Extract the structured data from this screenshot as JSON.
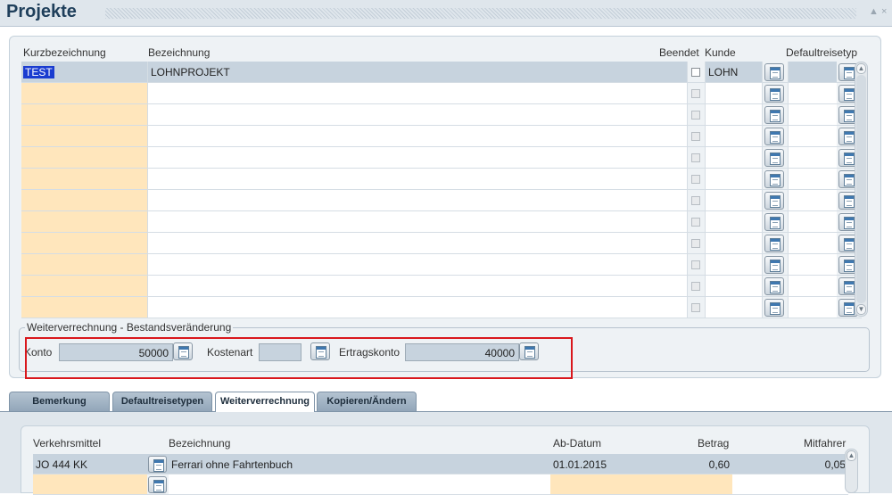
{
  "window": {
    "title": "Projekte",
    "minimize_glyph": "▲",
    "close_glyph": "×"
  },
  "projects": {
    "headers": {
      "kurz": "Kurzbezeichnung",
      "bezeichnung": "Bezeichnung",
      "beendet": "Beendet",
      "kunde": "Kunde",
      "defaultreisetyp": "Defaultreisetyp"
    },
    "rows": [
      {
        "kurz": "TEST",
        "bezeichnung": "LOHNPROJEKT",
        "beendet": false,
        "kunde": "LOHN",
        "reisetyp": ""
      },
      {
        "kurz": "",
        "bezeichnung": "",
        "beendet": false,
        "kunde": "",
        "reisetyp": ""
      },
      {
        "kurz": "",
        "bezeichnung": "",
        "beendet": false,
        "kunde": "",
        "reisetyp": ""
      },
      {
        "kurz": "",
        "bezeichnung": "",
        "beendet": false,
        "kunde": "",
        "reisetyp": ""
      },
      {
        "kurz": "",
        "bezeichnung": "",
        "beendet": false,
        "kunde": "",
        "reisetyp": ""
      },
      {
        "kurz": "",
        "bezeichnung": "",
        "beendet": false,
        "kunde": "",
        "reisetyp": ""
      },
      {
        "kurz": "",
        "bezeichnung": "",
        "beendet": false,
        "kunde": "",
        "reisetyp": ""
      },
      {
        "kurz": "",
        "bezeichnung": "",
        "beendet": false,
        "kunde": "",
        "reisetyp": ""
      },
      {
        "kurz": "",
        "bezeichnung": "",
        "beendet": false,
        "kunde": "",
        "reisetyp": ""
      },
      {
        "kurz": "",
        "bezeichnung": "",
        "beendet": false,
        "kunde": "",
        "reisetyp": ""
      },
      {
        "kurz": "",
        "bezeichnung": "",
        "beendet": false,
        "kunde": "",
        "reisetyp": ""
      },
      {
        "kurz": "",
        "bezeichnung": "",
        "beendet": false,
        "kunde": "",
        "reisetyp": ""
      }
    ]
  },
  "weiterverrechnung": {
    "legend": "Weiterverrechnung - Bestandsveränderung",
    "konto_label": "Konto",
    "konto_value": "50000",
    "kostenart_label": "Kostenart",
    "kostenart_value": "",
    "ertragskonto_label": "Ertragskonto",
    "ertragskonto_value": "40000"
  },
  "tabs": [
    {
      "label": "Bemerkung",
      "active": false
    },
    {
      "label": "Defaultreisetypen",
      "active": false
    },
    {
      "label": "Weiterverrechnung",
      "active": true
    },
    {
      "label": "Kopieren/Ändern",
      "active": false
    }
  ],
  "vehicles": {
    "headers": {
      "verkehrsmittel": "Verkehrsmittel",
      "bezeichnung": "Bezeichnung",
      "abdatum": "Ab-Datum",
      "betrag": "Betrag",
      "mitfahrer": "Mitfahrer"
    },
    "rows": [
      {
        "verkehrsmittel": "JO 444 KK",
        "bezeichnung": "Ferrari ohne Fahrtenbuch",
        "abdatum": "01.01.2015",
        "betrag": "0,60",
        "mitfahrer": "0,05"
      },
      {
        "verkehrsmittel": "",
        "bezeichnung": "",
        "abdatum": "",
        "betrag": "",
        "mitfahrer": ""
      }
    ]
  },
  "colors": {
    "required_field": "#ffe6bc",
    "selected_row": "#c7d3de",
    "highlight_box": "#d9171c",
    "title_text": "#1f3f5b"
  }
}
